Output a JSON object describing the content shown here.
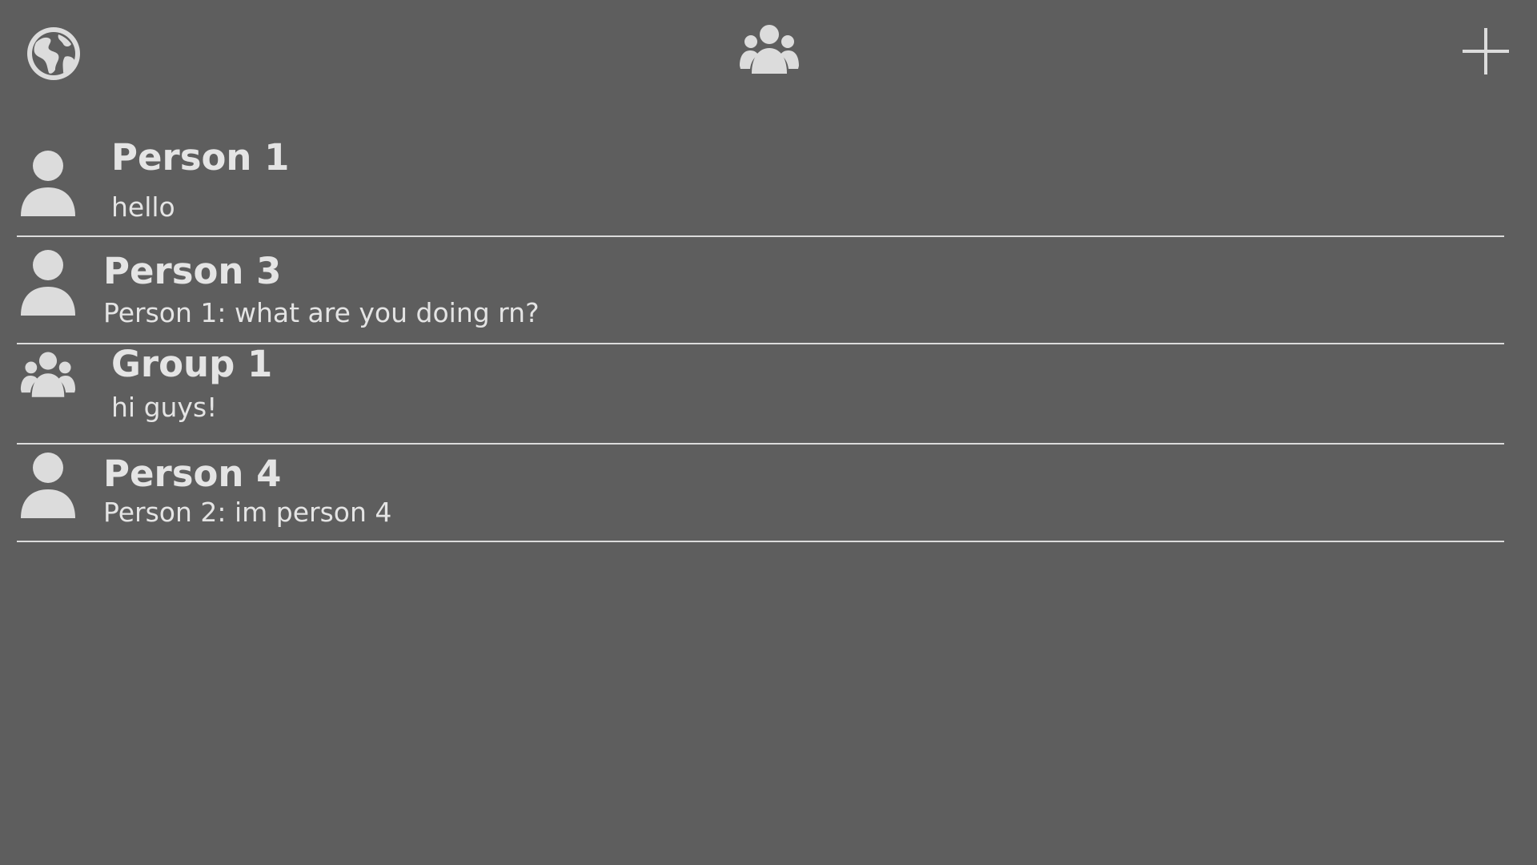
{
  "colors": {
    "background": "#5e5e5e",
    "icon": "#dcdcdc",
    "text": "#e4e4e4",
    "divider": "#dcdcdc"
  },
  "toolbar": {
    "left_icon": "globe-icon",
    "center_icon": "group-icon",
    "right_icon": "plus-icon"
  },
  "chats": [
    {
      "icon": "person-icon",
      "title": "Person 1",
      "preview": "hello"
    },
    {
      "icon": "person-icon",
      "title": "Person 3",
      "preview": "Person 1: what are you doing rn?"
    },
    {
      "icon": "group-icon",
      "title": "Group 1",
      "preview": "hi guys!"
    },
    {
      "icon": "person-icon",
      "title": "Person 4",
      "preview": "Person 2: im person 4"
    }
  ]
}
